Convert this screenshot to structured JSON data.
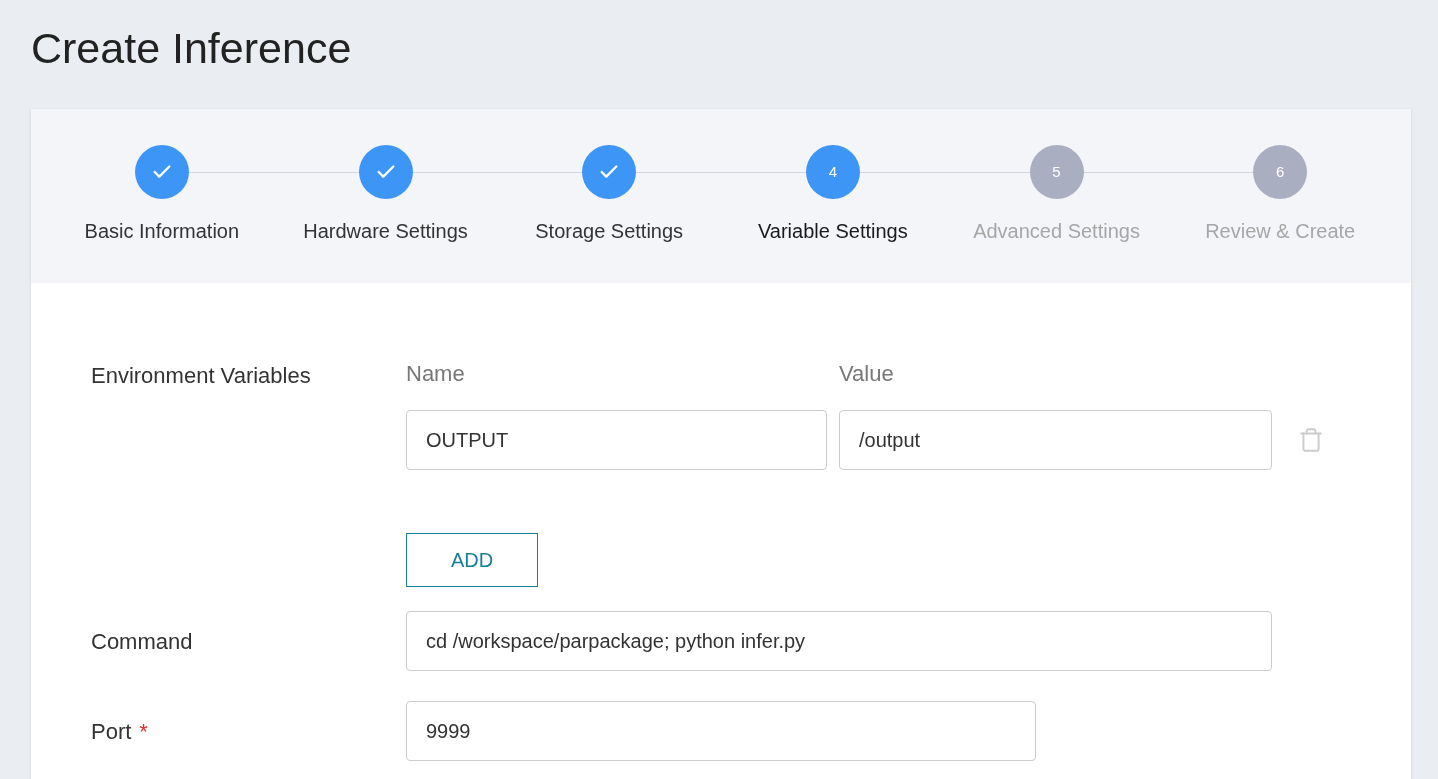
{
  "title": "Create Inference",
  "steps": [
    {
      "label": "Basic Information",
      "completed": true,
      "selected": false
    },
    {
      "label": "Hardware Settings",
      "completed": true,
      "selected": false
    },
    {
      "label": "Storage Settings",
      "completed": true,
      "selected": false
    },
    {
      "number": "4",
      "label": "Variable Settings",
      "completed": false,
      "selected": true
    },
    {
      "number": "5",
      "label": "Advanced Settings",
      "completed": false,
      "selected": false
    },
    {
      "number": "6",
      "label": "Review & Create",
      "completed": false,
      "selected": false
    }
  ],
  "env": {
    "label": "Environment Variables",
    "name_header": "Name",
    "value_header": "Value",
    "rows": [
      {
        "name": "OUTPUT",
        "value": "/output"
      }
    ],
    "add_button": "ADD"
  },
  "command": {
    "label": "Command",
    "value": "cd /workspace/parpackage; python infer.py"
  },
  "port": {
    "label": "Port",
    "value": "9999",
    "required": true,
    "required_mark": "*"
  }
}
